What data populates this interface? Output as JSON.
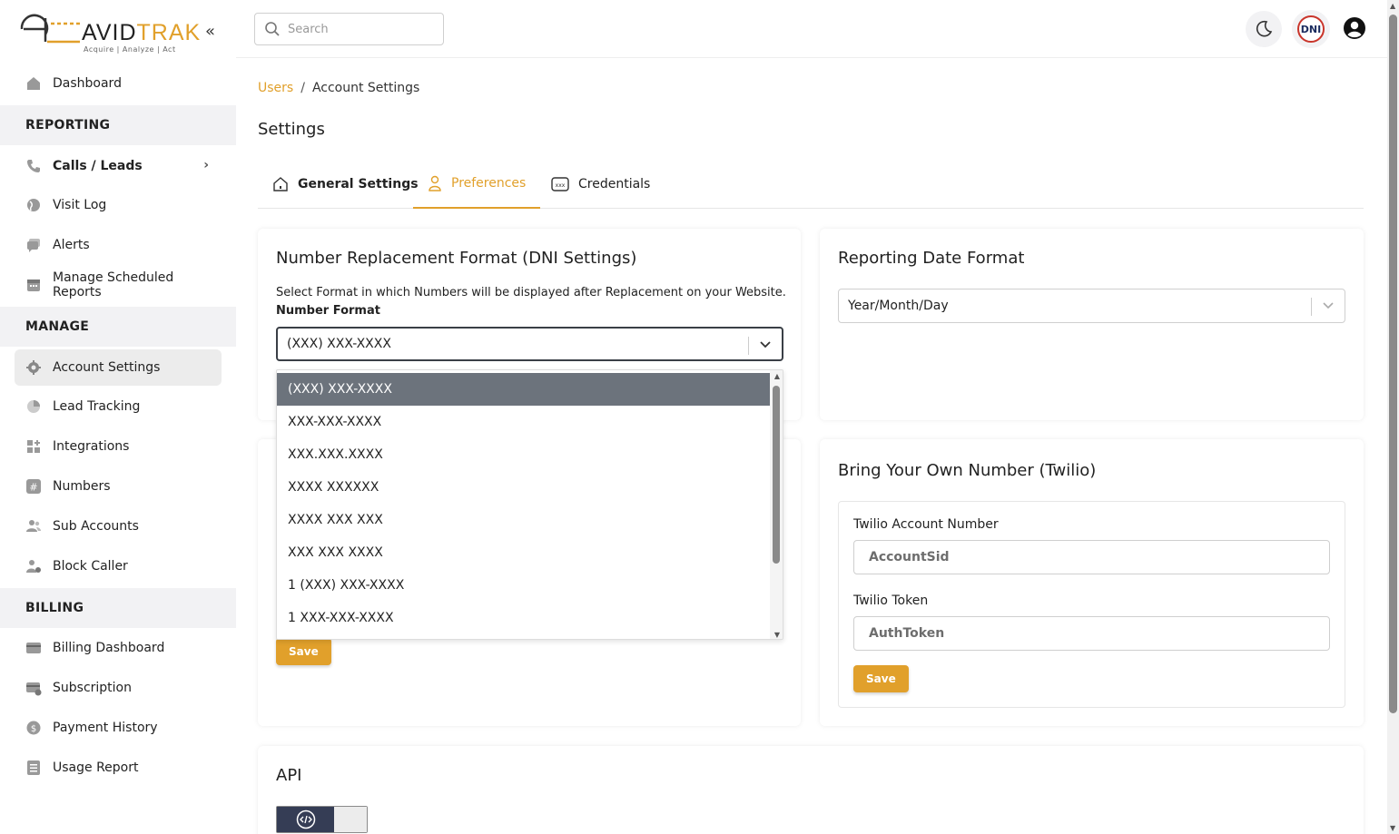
{
  "brand": {
    "name_part1": "AVID",
    "name_part2": "TRAK",
    "tagline": "Acquire  |  Analyze  |  Act",
    "accent": "#e1a02b"
  },
  "sidebar": {
    "items": [
      {
        "label": "Dashboard",
        "icon": "home-icon"
      },
      {
        "label": "Calls / Leads",
        "icon": "phone-icon"
      },
      {
        "label": "Visit Log",
        "icon": "globe-icon"
      },
      {
        "label": "Alerts",
        "icon": "chat-icon"
      },
      {
        "label": "Manage Scheduled Reports",
        "icon": "calendar-icon"
      },
      {
        "label": "Account Settings",
        "icon": "gear-icon"
      },
      {
        "label": "Lead Tracking",
        "icon": "pie-icon"
      },
      {
        "label": "Integrations",
        "icon": "grid-plus-icon"
      },
      {
        "label": "Numbers",
        "icon": "hash-icon"
      },
      {
        "label": "Sub Accounts",
        "icon": "users-icon"
      },
      {
        "label": "Block Caller",
        "icon": "user-block-icon"
      },
      {
        "label": "Billing Dashboard",
        "icon": "card-icon"
      },
      {
        "label": "Subscription",
        "icon": "card-refresh-icon"
      },
      {
        "label": "Payment History",
        "icon": "dollar-icon"
      },
      {
        "label": "Usage Report",
        "icon": "list-icon"
      }
    ],
    "sections": {
      "reporting": "REPORTING",
      "manage": "MANAGE",
      "billing": "BILLING"
    }
  },
  "topbar": {
    "search_placeholder": "Search",
    "dni_badge": "DNI"
  },
  "breadcrumb": {
    "link": "Users",
    "separator": "/",
    "current": "Account Settings"
  },
  "page": {
    "title": "Settings"
  },
  "tabs": [
    {
      "label": "General Settings"
    },
    {
      "label": "Preferences"
    },
    {
      "label": "Credentials"
    }
  ],
  "dni_card": {
    "title": "Number Replacement Format (DNI Settings)",
    "description": "Select Format in which Numbers will be displayed after Replacement on your Website.",
    "field_label": "Number Format",
    "selected": "(XXX) XXX-XXXX",
    "options": [
      "(XXX) XXX-XXXX",
      "XXX-XXX-XXXX",
      "XXX.XXX.XXXX",
      "XXXX XXXXXX",
      "XXXX XXX XXX",
      "XXX XXX XXXX",
      "1 (XXX) XXX-XXXX",
      "1 XXX-XXX-XXXX"
    ],
    "save_label": "Save"
  },
  "date_card": {
    "title": "Reporting Date Format",
    "selected": "Year/Month/Day"
  },
  "twilio_card": {
    "title": "Bring Your Own Number (Twilio)",
    "account_label": "Twilio Account Number",
    "account_placeholder": "AccountSid",
    "token_label": "Twilio Token",
    "token_placeholder": "AuthToken",
    "save_label": "Save"
  },
  "api_card": {
    "title": "API"
  }
}
